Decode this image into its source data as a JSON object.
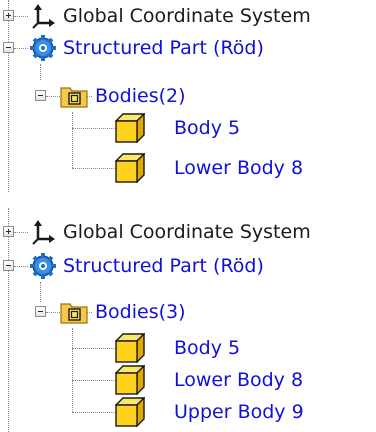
{
  "panels": [
    {
      "items": [
        {
          "label": "Global Coordinate System",
          "icon": "axes-icon",
          "expander": "plus"
        },
        {
          "label": "Structured Part (Röd)",
          "icon": "part-gear-icon",
          "expander": "minus"
        },
        {
          "label": "Bodies(2)",
          "icon": "folder-icon",
          "expander": "minus"
        },
        {
          "label": "Body 5",
          "icon": "body-cube-icon"
        },
        {
          "label": "Lower Body 8",
          "icon": "body-cube-icon"
        }
      ]
    },
    {
      "items": [
        {
          "label": "Global Coordinate System",
          "icon": "axes-icon",
          "expander": "plus"
        },
        {
          "label": "Structured Part (Röd)",
          "icon": "part-gear-icon",
          "expander": "minus"
        },
        {
          "label": "Bodies(3)",
          "icon": "folder-icon",
          "expander": "minus"
        },
        {
          "label": "Body 5",
          "icon": "body-cube-icon"
        },
        {
          "label": "Lower Body 8",
          "icon": "body-cube-icon"
        },
        {
          "label": "Upper Body 9",
          "icon": "body-cube-icon"
        }
      ]
    }
  ],
  "colors": {
    "link_text": "#1010d8",
    "text": "#1a1a1a",
    "cube_fill": "#ffd21f",
    "folder_fill": "#f3c84b",
    "gear_blue": "#1e6ec8"
  }
}
